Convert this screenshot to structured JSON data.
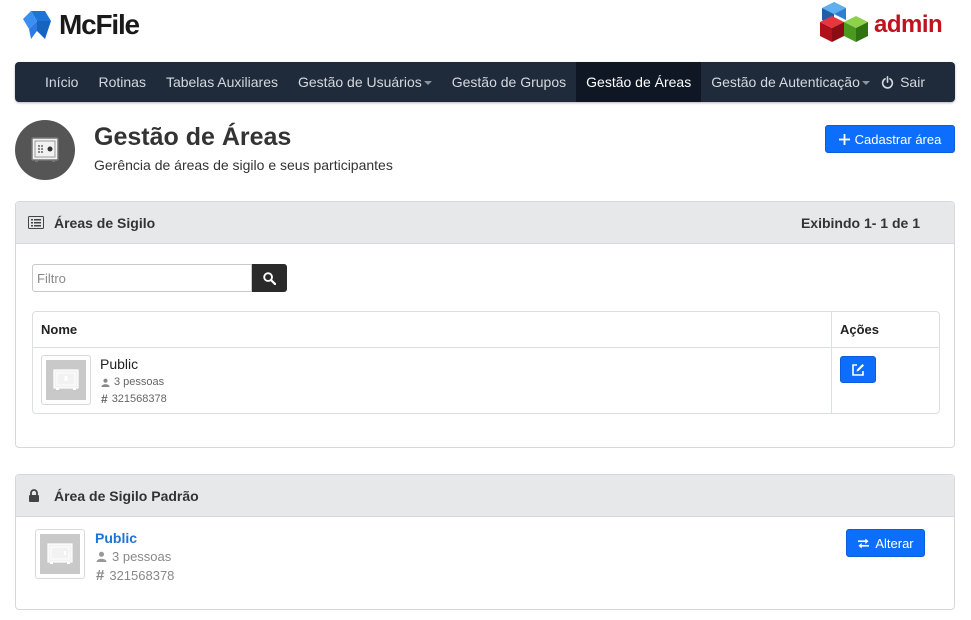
{
  "brand": {
    "name": "McFile",
    "logo_icon": "mcfile-logo-icon"
  },
  "admin_logo": {
    "text": "admin",
    "icon": "cubes-icon"
  },
  "nav": {
    "items": [
      {
        "label": "Início",
        "dropdown": false,
        "active": false
      },
      {
        "label": "Rotinas",
        "dropdown": false,
        "active": false
      },
      {
        "label": "Tabelas Auxiliares",
        "dropdown": false,
        "active": false
      },
      {
        "label": "Gestão de Usuários",
        "dropdown": true,
        "active": false
      },
      {
        "label": "Gestão de Grupos",
        "dropdown": false,
        "active": false
      },
      {
        "label": "Gestão de Áreas",
        "dropdown": false,
        "active": true
      },
      {
        "label": "Gestão de Autenticação",
        "dropdown": true,
        "active": false
      }
    ],
    "exit_label": "Sair"
  },
  "page": {
    "title": "Gestão de Áreas",
    "subtitle": "Gerência de áreas de sigilo e seus participantes",
    "new_button": "Cadastrar área"
  },
  "areas_panel": {
    "title": "Áreas de Sigilo",
    "count_text": "Exibindo 1- 1 de 1",
    "filter_placeholder": "Filtro",
    "columns": {
      "name": "Nome",
      "actions": "Ações"
    },
    "rows": [
      {
        "name": "Public",
        "people": "3 pessoas",
        "id": "321568378"
      }
    ]
  },
  "default_panel": {
    "title": "Área de Sigilo Padrão",
    "name": "Public",
    "people": "3 pessoas",
    "id": "321568378",
    "change_button": "Alterar"
  },
  "colors": {
    "navbar": "#1f2a3a",
    "navbar_active": "#0f1724",
    "primary": "#0d6efd",
    "link": "#1e73d8",
    "admin_red": "#c1121f"
  }
}
